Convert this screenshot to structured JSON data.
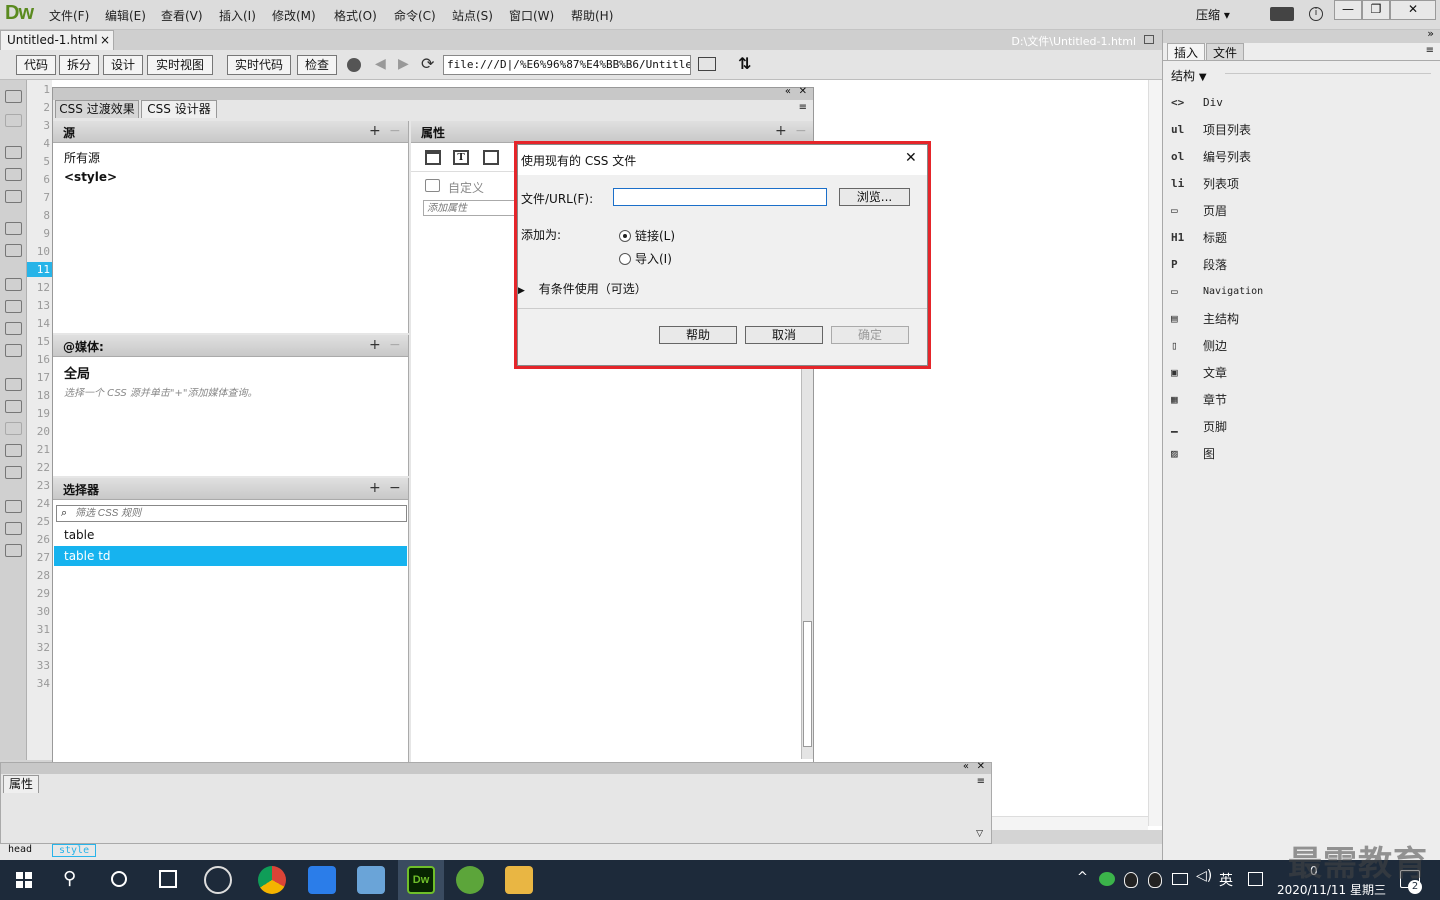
{
  "app": {
    "logo": "Dw",
    "compress": "压缩",
    "compress_arrow": "▾",
    "window_buttons": [
      "—",
      "❐",
      "✕"
    ]
  },
  "menu": [
    "文件(F)",
    "编辑(E)",
    "查看(V)",
    "插入(I)",
    "修改(M)",
    "格式(O)",
    "命令(C)",
    "站点(S)",
    "窗口(W)",
    "帮助(H)"
  ],
  "document": {
    "tab_name": "Untitled-1.html",
    "tab_close": "×",
    "path": "D:\\文件\\Untitled-1.html"
  },
  "toolbar": {
    "buttons": [
      "代码",
      "拆分",
      "设计",
      "实时视图",
      "实时代码",
      "检查"
    ],
    "address": "file:///D|/%E6%96%87%E4%BB%B6/Untitled"
  },
  "line_numbers": [
    "1",
    "2",
    "3",
    "4",
    "5",
    "6",
    "7",
    "8",
    "9",
    "10",
    "11",
    "12",
    "13",
    "14",
    "15",
    "16",
    "17",
    "18",
    "19",
    "20",
    "21",
    "22",
    "23",
    "24",
    "25",
    "26",
    "27",
    "28",
    "29",
    "30",
    "31",
    "32",
    "33",
    "34"
  ],
  "css_panel": {
    "tabs": [
      "CSS 过渡效果",
      "CSS 设计器"
    ],
    "sources": {
      "title": "源",
      "items": [
        "所有源",
        "<style>"
      ]
    },
    "media": {
      "title": "@媒体:",
      "global": "全局",
      "hint": "选择一个 CSS 源并单击\"+\"添加媒体查询。"
    },
    "selectors": {
      "title": "选择器",
      "filter_placeholder": "筛选 CSS 规则",
      "items": [
        "table",
        "table td"
      ]
    },
    "properties": {
      "title": "属性",
      "custom": "自定义",
      "add_placeholder": "添加属性"
    },
    "add": "+",
    "remove": "−"
  },
  "dialog": {
    "title": "使用现有的 CSS 文件",
    "close": "✕",
    "file_label": "文件/URL(F):",
    "file_value": "",
    "browse": "浏览...",
    "add_as": "添加为:",
    "link": "链接(L)",
    "import": "导入(I)",
    "conditional": "有条件使用（可选）",
    "help": "帮助",
    "cancel": "取消",
    "ok": "确定",
    "selected": "link",
    "accent": "#e5252a"
  },
  "insert_panel": {
    "tabs": [
      "插入",
      "文件"
    ],
    "category": "结构",
    "items": [
      {
        "icon": "<>",
        "label": "Div"
      },
      {
        "icon": "ul",
        "label": "项目列表"
      },
      {
        "icon": "ol",
        "label": "编号列表"
      },
      {
        "icon": "li",
        "label": "列表项"
      },
      {
        "icon": "▭",
        "label": "页眉"
      },
      {
        "icon": "H1",
        "label": "标题"
      },
      {
        "icon": "P",
        "label": "段落"
      },
      {
        "icon": "▭",
        "label": "Navigation"
      },
      {
        "icon": "▤",
        "label": "主结构"
      },
      {
        "icon": "▯",
        "label": "侧边"
      },
      {
        "icon": "▣",
        "label": "文章"
      },
      {
        "icon": "▦",
        "label": "章节"
      },
      {
        "icon": "▁",
        "label": "页脚"
      },
      {
        "icon": "▨",
        "label": "图"
      }
    ]
  },
  "properties_bar": {
    "title": "属性"
  },
  "status_bar": {
    "tags": [
      "head",
      "style"
    ]
  },
  "taskbar": {
    "ime": "英",
    "date": "2020/11/11 星期三",
    "time": "0",
    "notif_count": "2"
  },
  "watermark": "最需教育"
}
